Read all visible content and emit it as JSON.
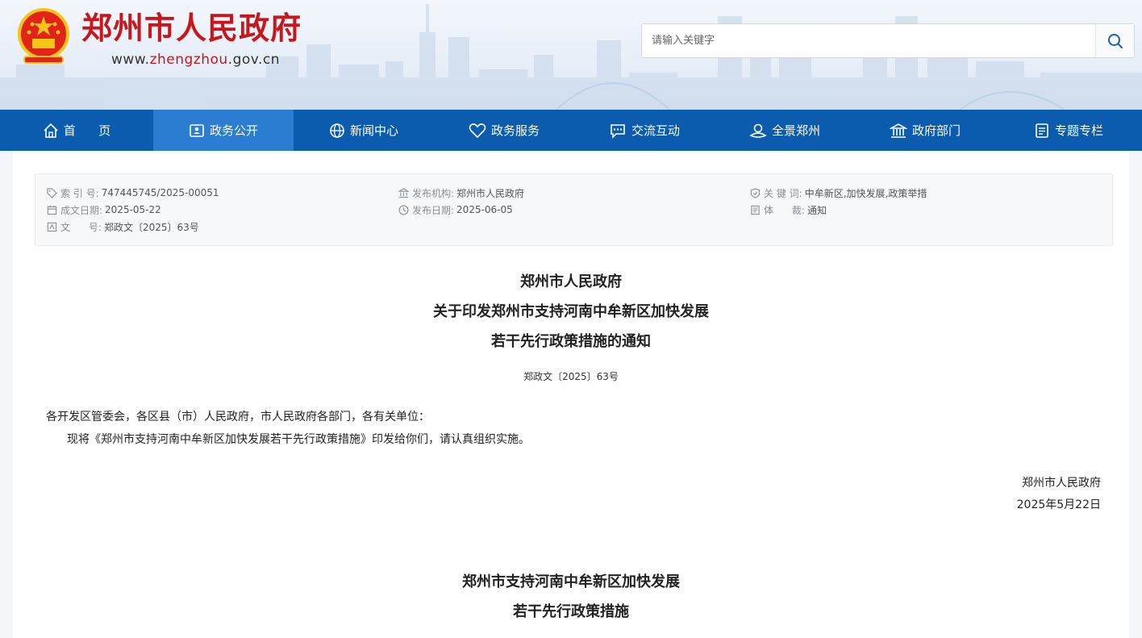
{
  "header": {
    "site_title": "郑州市人民政府",
    "url_prefix": "www.",
    "url_highlight": "zhengzhou",
    "url_suffix": ".gov.cn",
    "search_placeholder": "请输入关键字"
  },
  "nav": [
    {
      "label": "首      页",
      "icon": "home-icon"
    },
    {
      "label": "政务公开",
      "icon": "id-card-icon"
    },
    {
      "label": "新闻中心",
      "icon": "globe-icon"
    },
    {
      "label": "政务服务",
      "icon": "heart-icon"
    },
    {
      "label": "交流互动",
      "icon": "chat-icon"
    },
    {
      "label": "全景郑州",
      "icon": "panorama-icon"
    },
    {
      "label": "政府部门",
      "icon": "building-icon"
    },
    {
      "label": "专题专栏",
      "icon": "column-icon"
    }
  ],
  "meta": {
    "index_label": "索 引 号:",
    "index_value": "747445745/2025-00051",
    "created_label": "成文日期:",
    "created_value": "2025-05-22",
    "docno_label": "文      号:",
    "docno_value": "郑政文〔2025〕63号",
    "issuer_label": "发布机构:",
    "issuer_value": "郑州市人民政府",
    "pubdate_label": "发布日期:",
    "pubdate_value": "2025-06-05",
    "keywords_label": "关 键 词:",
    "keywords_value": "中牟新区,加快发展,政策举措",
    "genre_label": "体      裁:",
    "genre_value": "通知"
  },
  "doc": {
    "title_line1": "郑州市人民政府",
    "title_line2": "关于印发郑州市支持河南中牟新区加快发展",
    "title_line3": "若干先行政策措施的通知",
    "number": "郑政文〔2025〕63号",
    "salutation": "各开发区管委会，各区县（市）人民政府，市人民政府各部门，各有关单位：",
    "body": "现将《郑州市支持河南中牟新区加快发展若干先行政策措施》印发给你们，请认真组织实施。",
    "sign_org": "郑州市人民政府",
    "sign_date": "2025年5月22日",
    "attach_title1": "郑州市支持河南中牟新区加快发展",
    "attach_title2": "若干先行政策措施"
  },
  "colors": {
    "nav_bg": "#0b5cae",
    "nav_active": "#2a7dd1",
    "title_red": "#c8161d"
  }
}
